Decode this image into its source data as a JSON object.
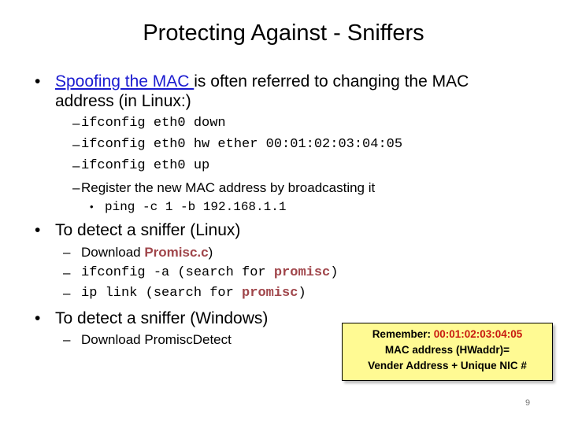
{
  "title": "Protecting Against - Sniffers",
  "bullets": [
    {
      "link_text": "Spoofing the MAC ",
      "text_after": "is often referred to changing the MAC",
      "text_line2": "address (in Linux:)",
      "sub_items": [
        "ifconfig eth0 down",
        "ifconfig eth0 hw ether 00:01:02:03:04:05",
        "ifconfig eth0 up",
        "Register the new MAC address by broadcasting it"
      ],
      "sub_sub_item": "ping -c 1 -b 192.168.1.1"
    },
    {
      "text": "To detect a sniffer (Linux)",
      "sub_items": [
        {
          "prefix": "Download ",
          "highlight": "Promisc.c",
          "suffix": ")"
        },
        {
          "prefix": "ifconfig -a (search for ",
          "highlight": "promisc",
          "suffix": ")"
        },
        {
          "prefix": "ip link (search for ",
          "highlight": "promisc",
          "suffix": ")"
        }
      ]
    },
    {
      "text": "To detect a sniffer (Windows)",
      "sub_items": [
        "Download PromiscDetect"
      ]
    }
  ],
  "callout": {
    "label": "Remember: ",
    "mac": "00:01:02:03:04:05",
    "line2": "MAC address (HWaddr)=",
    "line3": "Vender Address + Unique NIC #"
  },
  "page_number": "9",
  "glyphs": {
    "bullet": "•",
    "dash": "–"
  }
}
